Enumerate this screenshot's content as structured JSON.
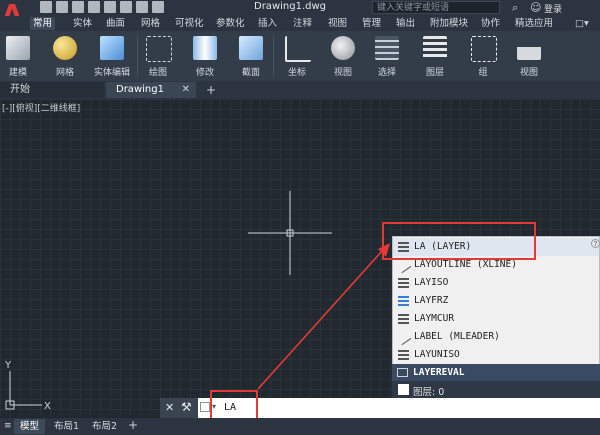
{
  "app": {
    "title": "Drawing1.dwg",
    "search_placeholder": "键入关键字或短语",
    "login": "登录"
  },
  "menu": [
    "常用",
    "实体",
    "曲面",
    "网格",
    "可视化",
    "参数化",
    "插入",
    "注释",
    "视图",
    "管理",
    "输出",
    "附加模块",
    "协作",
    "精选应用"
  ],
  "ribbon": [
    "建模",
    "网格",
    "实体编辑",
    "绘图",
    "修改",
    "截面",
    "坐标",
    "视图",
    "选择",
    "图层",
    "组",
    "视图"
  ],
  "tabs": {
    "start": "开始",
    "document": "Drawing1"
  },
  "viewport": {
    "label": "[-][俯视][二维线框]"
  },
  "autocomplete": {
    "items": [
      "LA (LAYER)",
      "LAYOUTLINE (XLINE)",
      "LAYISO",
      "LAYFRZ",
      "LAYMCUR",
      "LABEL (MLEADER)",
      "LAYUNISO"
    ],
    "layereval": "LAYEREVAL",
    "layer_label": "图层: 0"
  },
  "command": {
    "input": "LA"
  },
  "ucs": {
    "y": "Y",
    "x": "X"
  },
  "status_tabs": [
    "模型",
    "布局1",
    "布局2"
  ],
  "colors": {
    "accent_red": "#e53935",
    "background": "#212830"
  }
}
